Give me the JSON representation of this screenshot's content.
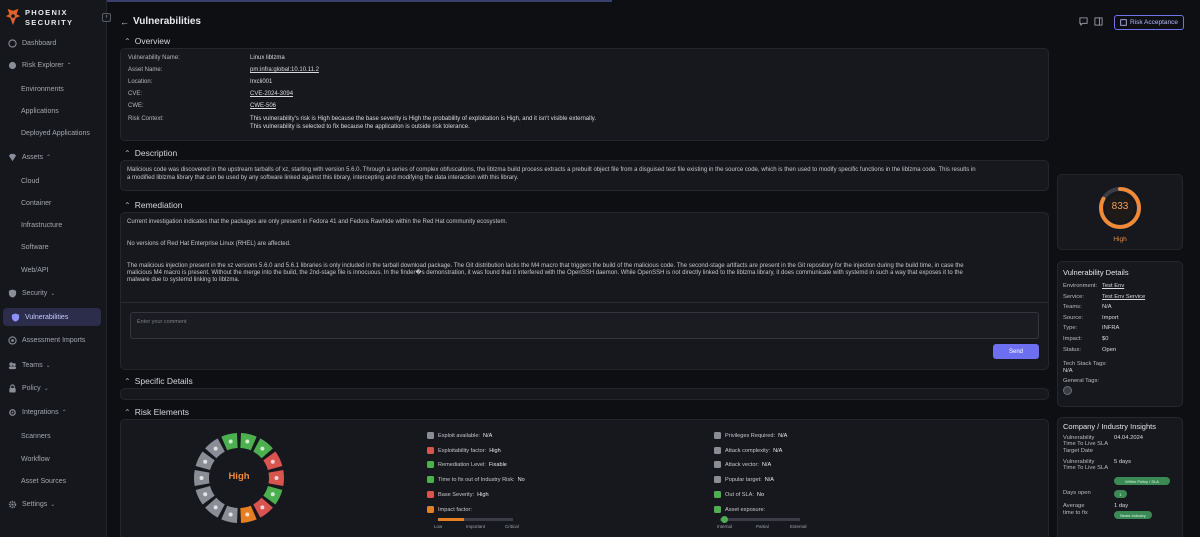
{
  "brand": {
    "line1": "PHOENIX",
    "line2": "SECURITY"
  },
  "sidebar": {
    "items": [
      {
        "label": "Dashboard",
        "icon": "dashboard-icon"
      },
      {
        "label": "Risk Explorer",
        "icon": "risk-explorer-icon"
      },
      {
        "label": "Environments"
      },
      {
        "label": "Applications"
      },
      {
        "label": "Deployed Applications"
      },
      {
        "label": "Assets",
        "icon": "assets-icon"
      },
      {
        "label": "Cloud"
      },
      {
        "label": "Container"
      },
      {
        "label": "Infrastructure"
      },
      {
        "label": "Software"
      },
      {
        "label": "Web/API"
      },
      {
        "label": "Security",
        "icon": "shield-icon"
      },
      {
        "label": "Vulnerabilities",
        "icon": "vulnerabilities-icon"
      },
      {
        "label": "Assessment Imports",
        "icon": "import-icon"
      },
      {
        "label": "Teams",
        "icon": "teams-icon"
      },
      {
        "label": "Policy",
        "icon": "lock-icon"
      },
      {
        "label": "Integrations",
        "icon": "integrations-icon"
      },
      {
        "label": "Scanners"
      },
      {
        "label": "Workflow"
      },
      {
        "label": "Asset Sources"
      },
      {
        "label": "Settings",
        "icon": "gear-icon"
      }
    ]
  },
  "header": {
    "title": "Vulnerabilities",
    "risk_acceptance": "Risk Acceptance"
  },
  "overview": {
    "heading": "Overview",
    "rows": [
      {
        "key": "Vulnerability Name:",
        "value": "Linux liblzma"
      },
      {
        "key": "Asset Name:",
        "value": "pm:infra:global:10.10.11.2"
      },
      {
        "key": "Location:",
        "value": "Irxcli001"
      },
      {
        "key": "CVE:",
        "value": "CVE-2024-3094"
      },
      {
        "key": "CWE:",
        "value": "CWE-506"
      },
      {
        "key": "Risk Context:",
        "value": "This vulnerability's risk is High because the base severity is High the probability of exploitation is High, and it isn't visible externally."
      }
    ],
    "risk_context_line2": "This vulnerability is selected to fix because the application is outside risk tolerance."
  },
  "description": {
    "heading": "Description",
    "line1": "Malicious code was discovered in the upstream tarballs of xz, starting with version 5.6.0. Through a series of complex obfuscations, the liblzma build process extracts a prebuilt object file from a disguised test file existing in the source code, which is then used to modify specific functions in the liblzma code. This results in",
    "line2": "a modified liblzma library that can be used by any software linked against this library, intercepting and modifying the data interaction with this library."
  },
  "remediation": {
    "heading": "Remediation",
    "p1": "Current investigation indicates that the packages are only present in Fedora 41 and Fedora Rawhide within the Red Hat community ecosystem.",
    "p2": "No versions of Red Hat Enterprise Linux (RHEL) are affected.",
    "p3a": "The malicious injection present in the xz versions 5.6.0 and 5.6.1 libraries is only included in the tarball download package. The Git distribution lacks the M4 macro that triggers the build of the malicious code. The second-stage artifacts are present in the Git repository for the injection during the build time, in case the",
    "p3b": "malicious M4 macro is present. Without the merge into the build, the 2nd-stage file is innocuous. In the finder�s demonstration, it was found that it interfered with the OpenSSH daemon. While OpenSSH is not directly linked to the liblzma library, it does communicate with systemd in such a way that exposes it to the",
    "p3c": "malware due to systemd linking to liblzma.",
    "comment_placeholder": "Enter your comment",
    "send": "Send"
  },
  "specific_details": {
    "heading": "Specific Details"
  },
  "risk_elements": {
    "heading": "Risk Elements",
    "wheel_label": "High",
    "left": [
      {
        "label": "Exploit available:",
        "value": "N/A",
        "color": "#8a8d95"
      },
      {
        "label": "Exploitability factor:",
        "value": "High",
        "color": "#d9534f"
      },
      {
        "label": "Remediation Level:",
        "value": "Fixable",
        "color": "#4caf50"
      },
      {
        "label": "Time to fix out of Industry Risk:",
        "value": "No",
        "color": "#4caf50"
      },
      {
        "label": "Base Severity:",
        "value": "High",
        "color": "#d9534f"
      },
      {
        "label": "Impact factor:",
        "value": "",
        "color": "#e67e22"
      }
    ],
    "right": [
      {
        "label": "Privileges Required:",
        "value": "N/A",
        "color": "#8a8d95"
      },
      {
        "label": "Attack complexity:",
        "value": "N/A",
        "color": "#8a8d95"
      },
      {
        "label": "Attack vector:",
        "value": "N/A",
        "color": "#8a8d95"
      },
      {
        "label": "Popular target:",
        "value": "N/A",
        "color": "#8a8d95"
      },
      {
        "label": "Out of SLA:",
        "value": "No",
        "color": "#4caf50"
      },
      {
        "label": "Asset exposure:",
        "value": "",
        "color": "#4caf50"
      }
    ],
    "impact_scale": [
      "Low",
      "Important",
      "Critical"
    ],
    "impact_level": 0.35,
    "exposure_scale": [
      "Internal",
      "Partial",
      "External"
    ],
    "exposure_level": 0.0
  },
  "score": {
    "value": "833",
    "label": "High",
    "fraction": 0.83
  },
  "vuln_details": {
    "heading": "Vulnerability Details",
    "rows": [
      {
        "key": "Environment:",
        "value": "Test Env"
      },
      {
        "key": "Service:",
        "value": "Test Env Service"
      },
      {
        "key": "Teams:",
        "value": "N/A"
      },
      {
        "key": "Source:",
        "value": "Import"
      },
      {
        "key": "Type:",
        "value": "INFRA"
      },
      {
        "key": "Impact:",
        "value": "$0"
      },
      {
        "key": "Status:",
        "value": "Open"
      }
    ],
    "tech_stack_label": "Tech Stack Tags:",
    "tech_stack_value": "N/A",
    "general_tags_label": "General Tags:"
  },
  "insights": {
    "heading": "Company / Industry Insights",
    "r1k1": "Vulnerability",
    "r1k2": "Time To Live SLA",
    "r1k3": "Target Date",
    "r1v": "04.04.2024",
    "r2k1": "Vulnerability",
    "r2k2": "Time To Live SLA",
    "r2v": "5 days",
    "pill1": "Within Policy / SLA",
    "r3k": "Days open",
    "r3v": "1",
    "r4k1": "Average",
    "r4k2": "time to fix",
    "r4v": "1 day",
    "pill2": "Beats Industry"
  }
}
